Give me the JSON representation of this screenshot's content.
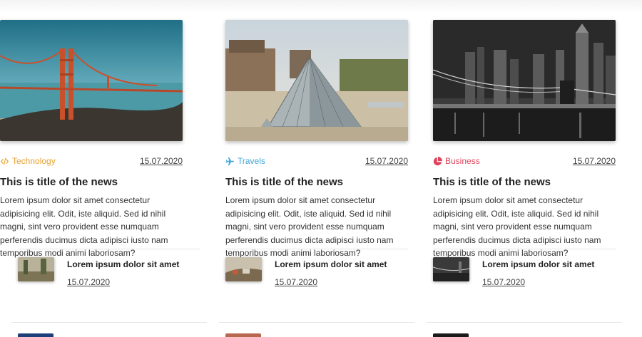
{
  "colors": {
    "travels": "#3fa6d6",
    "business": "#e0445c",
    "technology": "#e8a12f"
  },
  "cards": [
    {
      "category": "Travels",
      "category_icon": "airplane-icon",
      "date": "15.07.2020",
      "title": "This is title of the news",
      "excerpt": "Lorem ipsum dolor sit amet consectetur adipisicing elit. Odit, iste aliquid. Sed id nihil magni, sint vero provident esse numquam perferendis ducimus dicta adipisci iusto nam temporibus modi animi laboriosam?",
      "related": {
        "title": "Lorem ipsum dolor sit amet",
        "date": "15.07.2020"
      }
    },
    {
      "category": "Business",
      "category_icon": "pie-chart-icon",
      "date": "15.07.2020",
      "title": "This is title of the news",
      "excerpt": "Lorem ipsum dolor sit amet consectetur adipisicing elit. Odit, iste aliquid. Sed id nihil magni, sint vero provident esse numquam perferendis ducimus dicta adipisci iusto nam temporibus modi animi laboriosam?",
      "related": {
        "title": "Lorem ipsum dolor sit amet",
        "date": "15.07.2020"
      }
    },
    {
      "category": "Technology",
      "category_icon": "code-icon",
      "date": "15.07.2020",
      "title": "This is title of the news",
      "excerpt": "Lorem ipsum dolor sit amet consectetur adipisicing elit. Odit, iste aliquid. Sed id nihil magni, sint vero provident esse numquam perferendis ducimus dicta adipisci iusto nam temporibus modi animi laboriosam?",
      "related": {
        "title": "Lorem ipsum dolor sit amet",
        "date": "15.07.2020"
      }
    }
  ]
}
